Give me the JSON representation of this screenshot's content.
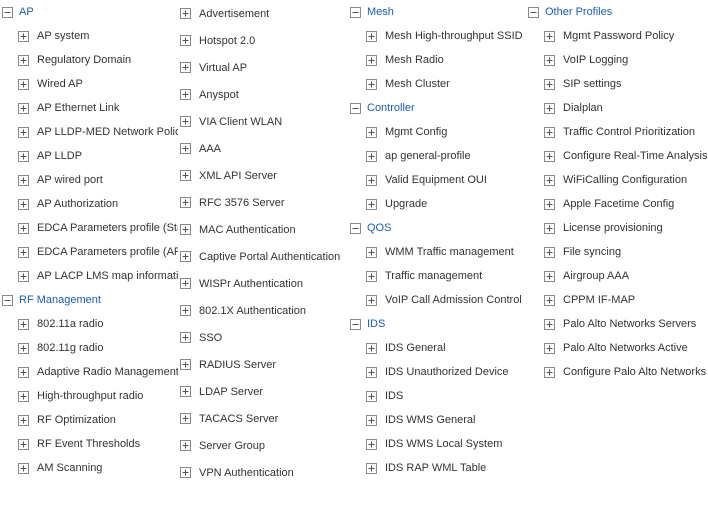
{
  "columns": [
    {
      "blocks": [
        {
          "type": "section",
          "icon": "minus",
          "name": "section-ap",
          "label": "AP"
        },
        {
          "type": "item",
          "icon": "plus",
          "name": "item-ap-system",
          "label": "AP system"
        },
        {
          "type": "item",
          "icon": "plus",
          "name": "item-regulatory-domain",
          "label": "Regulatory Domain"
        },
        {
          "type": "item",
          "icon": "plus",
          "name": "item-wired-ap",
          "label": "Wired AP"
        },
        {
          "type": "item",
          "icon": "plus",
          "name": "item-ap-ethernet-link",
          "label": "AP Ethernet Link"
        },
        {
          "type": "item",
          "icon": "plus",
          "name": "item-ap-lldp-med",
          "label": "AP LLDP-MED Network Policy"
        },
        {
          "type": "item",
          "icon": "plus",
          "name": "item-ap-lldp",
          "label": "AP LLDP"
        },
        {
          "type": "item",
          "icon": "plus",
          "name": "item-ap-wired-port",
          "label": "AP wired port"
        },
        {
          "type": "item",
          "icon": "plus",
          "name": "item-ap-authorization",
          "label": "AP Authorization"
        },
        {
          "type": "item",
          "icon": "plus",
          "name": "item-edca-station",
          "label": "EDCA Parameters profile (Station"
        },
        {
          "type": "item",
          "icon": "plus",
          "name": "item-edca-ap",
          "label": "EDCA Parameters profile (AP)"
        },
        {
          "type": "item",
          "icon": "plus",
          "name": "item-ap-lacp-lms",
          "label": "AP LACP LMS map information"
        },
        {
          "type": "section",
          "icon": "minus",
          "name": "section-rf-management",
          "label": "RF Management"
        },
        {
          "type": "item",
          "icon": "plus",
          "name": "item-80211a-radio",
          "label": "802.11a radio"
        },
        {
          "type": "item",
          "icon": "plus",
          "name": "item-80211g-radio",
          "label": "802.11g radio"
        },
        {
          "type": "item",
          "icon": "plus",
          "name": "item-adaptive-radio",
          "label": "Adaptive Radio Management (AR"
        },
        {
          "type": "item",
          "icon": "plus",
          "name": "item-high-throughput-radio",
          "label": "High-throughput radio"
        },
        {
          "type": "item",
          "icon": "plus",
          "name": "item-rf-optimization",
          "label": "RF Optimization"
        },
        {
          "type": "item",
          "icon": "plus",
          "name": "item-rf-event-thresholds",
          "label": "RF Event Thresholds"
        },
        {
          "type": "item",
          "icon": "plus",
          "name": "item-am-scanning",
          "label": "AM Scanning"
        }
      ]
    },
    {
      "blocks": [
        {
          "type": "item-noindent",
          "icon": "plus",
          "name": "item-advertisement",
          "label": "Advertisement"
        },
        {
          "type": "item-noindent",
          "icon": "plus",
          "name": "item-hotspot-20",
          "label": "Hotspot 2.0"
        },
        {
          "type": "item-noindent",
          "icon": "plus",
          "name": "item-virtual-ap",
          "label": "Virtual AP"
        },
        {
          "type": "item-noindent",
          "icon": "plus",
          "name": "item-anyspot",
          "label": "Anyspot"
        },
        {
          "type": "item-noindent",
          "icon": "plus",
          "name": "item-via-client-wlan",
          "label": "VIA Client WLAN"
        },
        {
          "type": "item-noindent",
          "icon": "plus",
          "name": "item-aaa",
          "label": "AAA"
        },
        {
          "type": "item-noindent",
          "icon": "plus",
          "name": "item-xml-api-server",
          "label": "XML API Server"
        },
        {
          "type": "item-noindent",
          "icon": "plus",
          "name": "item-rfc-3576-server",
          "label": "RFC 3576 Server"
        },
        {
          "type": "item-noindent",
          "icon": "plus",
          "name": "item-mac-authentication",
          "label": "MAC Authentication"
        },
        {
          "type": "item-noindent",
          "icon": "plus",
          "name": "item-captive-portal-auth",
          "label": "Captive Portal Authentication"
        },
        {
          "type": "item-noindent",
          "icon": "plus",
          "name": "item-wispr-auth",
          "label": "WISPr Authentication"
        },
        {
          "type": "item-noindent",
          "icon": "plus",
          "name": "item-8021x-auth",
          "label": "802.1X Authentication"
        },
        {
          "type": "item-noindent",
          "icon": "plus",
          "name": "item-sso",
          "label": "SSO"
        },
        {
          "type": "item-noindent",
          "icon": "plus",
          "name": "item-radius-server",
          "label": "RADIUS Server"
        },
        {
          "type": "item-noindent",
          "icon": "plus",
          "name": "item-ldap-server",
          "label": "LDAP Server"
        },
        {
          "type": "item-noindent",
          "icon": "plus",
          "name": "item-tacacs-server",
          "label": "TACACS Server"
        },
        {
          "type": "item-noindent",
          "icon": "plus",
          "name": "item-server-group",
          "label": "Server Group"
        },
        {
          "type": "item-noindent",
          "icon": "plus",
          "name": "item-vpn-authentication",
          "label": "VPN Authentication"
        }
      ]
    },
    {
      "blocks": [
        {
          "type": "section",
          "icon": "minus",
          "name": "section-mesh",
          "label": "Mesh"
        },
        {
          "type": "item",
          "icon": "plus",
          "name": "item-mesh-ht-ssid",
          "label": "Mesh High-throughput SSID"
        },
        {
          "type": "item",
          "icon": "plus",
          "name": "item-mesh-radio",
          "label": "Mesh Radio"
        },
        {
          "type": "item",
          "icon": "plus",
          "name": "item-mesh-cluster",
          "label": "Mesh Cluster"
        },
        {
          "type": "section",
          "icon": "minus",
          "name": "section-controller",
          "label": "Controller"
        },
        {
          "type": "item",
          "icon": "plus",
          "name": "item-mgmt-config",
          "label": "Mgmt Config"
        },
        {
          "type": "item",
          "icon": "plus",
          "name": "item-ap-general-profile",
          "label": "ap general-profile"
        },
        {
          "type": "item",
          "icon": "plus",
          "name": "item-valid-equipment-oui",
          "label": "Valid Equipment OUI"
        },
        {
          "type": "item",
          "icon": "plus",
          "name": "item-upgrade",
          "label": "Upgrade"
        },
        {
          "type": "section",
          "icon": "minus",
          "name": "section-qos",
          "label": "QOS"
        },
        {
          "type": "item",
          "icon": "plus",
          "name": "item-wmm-traffic-mgmt",
          "label": "WMM Traffic management"
        },
        {
          "type": "item",
          "icon": "plus",
          "name": "item-traffic-mgmt",
          "label": "Traffic management"
        },
        {
          "type": "item",
          "icon": "plus",
          "name": "item-voip-cac",
          "label": "VoIP Call Admission Control"
        },
        {
          "type": "section",
          "icon": "minus",
          "name": "section-ids",
          "label": "IDS"
        },
        {
          "type": "item",
          "icon": "plus",
          "name": "item-ids-general",
          "label": "IDS General"
        },
        {
          "type": "item",
          "icon": "plus",
          "name": "item-ids-unauthorized-device",
          "label": "IDS Unauthorized Device"
        },
        {
          "type": "item",
          "icon": "plus",
          "name": "item-ids",
          "label": "IDS"
        },
        {
          "type": "item",
          "icon": "plus",
          "name": "item-ids-wms-general",
          "label": "IDS WMS General"
        },
        {
          "type": "item",
          "icon": "plus",
          "name": "item-ids-wms-local-system",
          "label": "IDS WMS Local System"
        },
        {
          "type": "item",
          "icon": "plus",
          "name": "item-ids-rap-wml-table",
          "label": "IDS RAP WML Table"
        }
      ]
    },
    {
      "blocks": [
        {
          "type": "section",
          "icon": "minus",
          "name": "section-other-profiles",
          "label": "Other Profiles"
        },
        {
          "type": "item",
          "icon": "plus",
          "name": "item-mgmt-password-policy",
          "label": "Mgmt Password Policy"
        },
        {
          "type": "item",
          "icon": "plus",
          "name": "item-voip-logging",
          "label": "VoIP Logging"
        },
        {
          "type": "item",
          "icon": "plus",
          "name": "item-sip-settings",
          "label": "SIP settings"
        },
        {
          "type": "item",
          "icon": "plus",
          "name": "item-dialplan",
          "label": "Dialplan"
        },
        {
          "type": "item",
          "icon": "plus",
          "name": "item-traffic-control-prioritization",
          "label": "Traffic Control Prioritization"
        },
        {
          "type": "item",
          "icon": "plus",
          "name": "item-configure-real-time-analysis",
          "label": "Configure Real-Time Analysis"
        },
        {
          "type": "item",
          "icon": "plus",
          "name": "item-wificalling-configuration",
          "label": "WiFiCalling Configuration"
        },
        {
          "type": "item",
          "icon": "plus",
          "name": "item-apple-facetime-config",
          "label": "Apple Facetime Config"
        },
        {
          "type": "item",
          "icon": "plus",
          "name": "item-license-provisioning",
          "label": "License provisioning"
        },
        {
          "type": "item",
          "icon": "plus",
          "name": "item-file-syncing",
          "label": "File syncing"
        },
        {
          "type": "item",
          "icon": "plus",
          "name": "item-airgroup-aaa",
          "label": "Airgroup AAA"
        },
        {
          "type": "item",
          "icon": "plus",
          "name": "item-cppm-if-map",
          "label": "CPPM IF-MAP"
        },
        {
          "type": "item",
          "icon": "plus",
          "name": "item-palo-alto-networks-servers",
          "label": "Palo Alto Networks Servers"
        },
        {
          "type": "item",
          "icon": "plus",
          "name": "item-palo-alto-networks-active",
          "label": "Palo Alto Networks Active"
        },
        {
          "type": "item",
          "icon": "plus",
          "name": "item-configure-palo-alto-options",
          "label": "Configure Palo Alto Networks options"
        }
      ]
    }
  ]
}
